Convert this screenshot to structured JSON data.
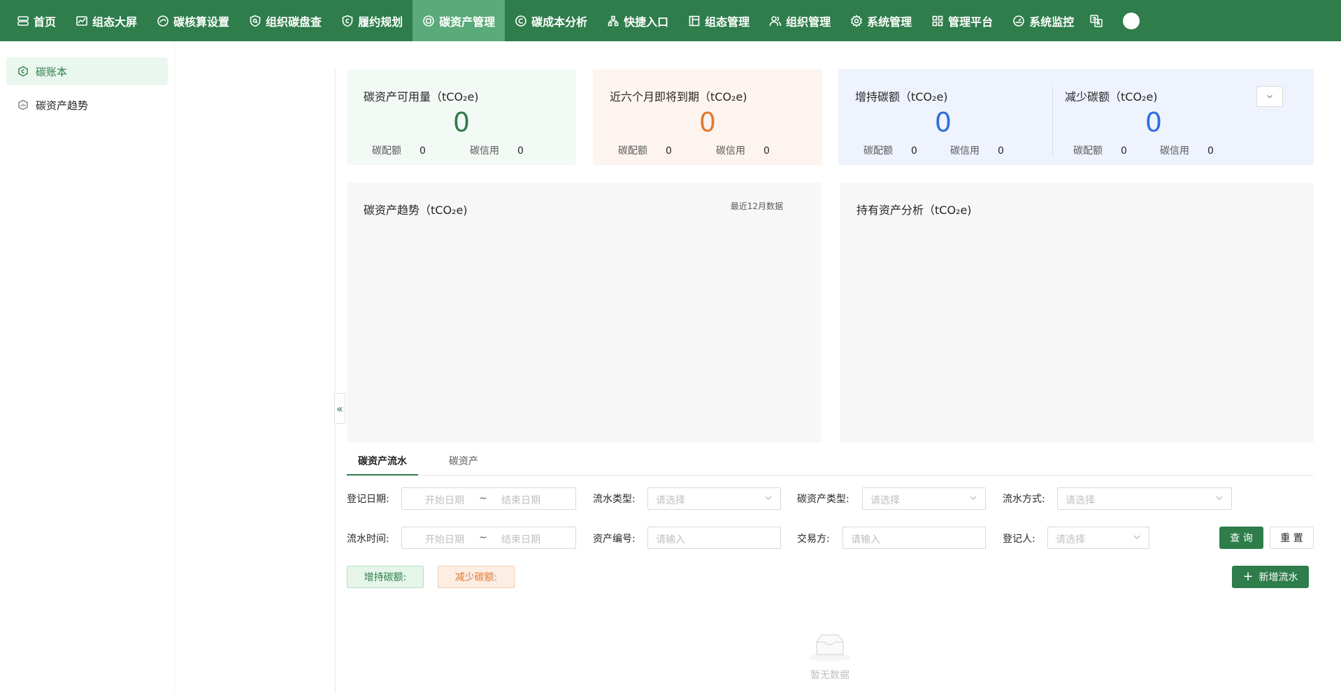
{
  "nav": {
    "items": [
      {
        "label": "首页",
        "icon": "server-icon"
      },
      {
        "label": "组态大屏",
        "icon": "chart-line-icon"
      },
      {
        "label": "碳核算设置",
        "icon": "co2-cloud-icon"
      },
      {
        "label": "组织碳盘查",
        "icon": "search-shield-icon"
      },
      {
        "label": "履约规划",
        "icon": "carbon-c-icon"
      },
      {
        "label": "碳资产管理",
        "icon": "carbon-asset-icon"
      },
      {
        "label": "碳成本分析",
        "icon": "carbon-c-circle-icon"
      },
      {
        "label": "快捷入口",
        "icon": "sitemap-icon"
      },
      {
        "label": "组态管理",
        "icon": "layout-icon"
      },
      {
        "label": "组织管理",
        "icon": "users-icon"
      },
      {
        "label": "系统管理",
        "icon": "gear-icon"
      },
      {
        "label": "管理平台",
        "icon": "grid-icon"
      },
      {
        "label": "系统监控",
        "icon": "dashboard-icon"
      }
    ],
    "active_index": 5
  },
  "sidebar": {
    "items": [
      {
        "label": "碳账本",
        "icon": "ledger-icon"
      },
      {
        "label": "碳资产趋势",
        "icon": "trend-icon"
      }
    ]
  },
  "stats": {
    "available": {
      "title": "碳资产可用量（tCO₂e)",
      "value": "0",
      "quota_label": "碳配额",
      "quota_value": "0",
      "credit_label": "碳信用",
      "credit_value": "0"
    },
    "expiring": {
      "title": "近六个月即将到期（tCO₂e)",
      "value": "0",
      "quota_label": "碳配额",
      "quota_value": "0",
      "credit_label": "碳信用",
      "credit_value": "0"
    },
    "increase": {
      "title": "增持碳额（tCO₂e)",
      "value": "0",
      "quota_label": "碳配额",
      "quota_value": "0",
      "credit_label": "碳信用",
      "credit_value": "0"
    },
    "decrease": {
      "title": "减少碳额（tCO₂e)",
      "value": "0",
      "quota_label": "碳配额",
      "quota_value": "0",
      "credit_label": "碳信用",
      "credit_value": "0"
    }
  },
  "panels": {
    "trend": {
      "title": "碳资产趋势（tCO₂e)",
      "note": "最近12月数据"
    },
    "holding": {
      "title": "持有资产分析（tCO₂e)"
    }
  },
  "tabs": [
    "碳资产流水",
    "碳资产"
  ],
  "filters": {
    "reg_date": {
      "label": "登记日期:",
      "start": "开始日期",
      "sep": "~",
      "end": "结束日期"
    },
    "flow_type": {
      "label": "流水类型:",
      "placeholder": "请选择"
    },
    "asset_type": {
      "label": "碳资产类型:",
      "placeholder": "请选择"
    },
    "flow_method": {
      "label": "流水方式:",
      "placeholder": "请选择"
    },
    "flow_time": {
      "label": "流水时间:",
      "start": "开始日期",
      "sep": "~",
      "end": "结束日期"
    },
    "asset_no": {
      "label": "资产编号:",
      "placeholder": "请输入"
    },
    "counterparty": {
      "label": "交易方:",
      "placeholder": "请输入"
    },
    "registrant": {
      "label": "登记人:",
      "placeholder": "请选择"
    }
  },
  "buttons": {
    "query": "查 询",
    "reset": "重 置",
    "add": "新增流水",
    "add_icon": "+"
  },
  "tags": {
    "increase": "增持碳额:",
    "decrease": "减少碳额:"
  },
  "empty": {
    "text": "暂无数据"
  },
  "colors": {
    "primary": "#2e7d4b",
    "green_value": "#2e7d4b",
    "orange_value": "#e07a2f",
    "blue_value": "#2f6fdc"
  }
}
